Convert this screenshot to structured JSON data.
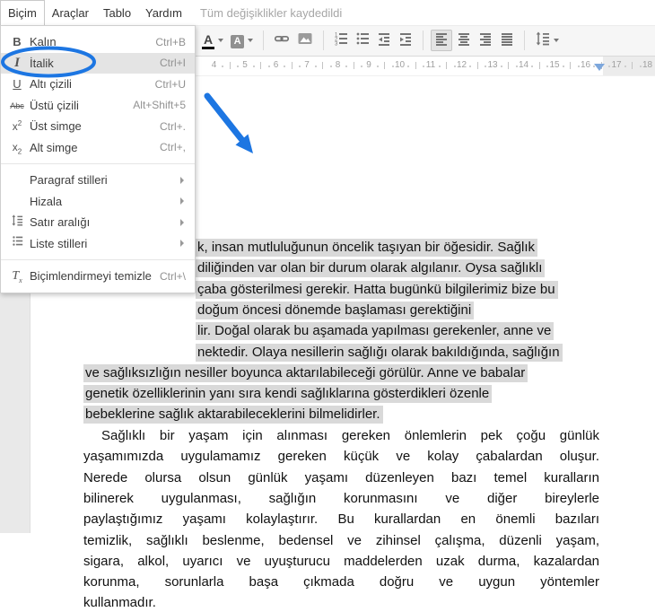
{
  "menubar": {
    "items": [
      "Biçim",
      "Araçlar",
      "Tablo",
      "Yardım"
    ],
    "status": "Tüm değişiklikler kaydedildi"
  },
  "toolbar": {
    "active": "align-left",
    "buttons": [
      {
        "name": "text-color",
        "caret": true
      },
      {
        "name": "highlight-color",
        "caret": true
      },
      {
        "sep": true
      },
      {
        "name": "insert-link"
      },
      {
        "name": "insert-image"
      },
      {
        "sep": true
      },
      {
        "name": "numbered-list"
      },
      {
        "name": "bulleted-list"
      },
      {
        "name": "decrease-indent"
      },
      {
        "name": "increase-indent"
      },
      {
        "sep": true
      },
      {
        "name": "align-left"
      },
      {
        "name": "align-center"
      },
      {
        "name": "align-right"
      },
      {
        "name": "justify"
      },
      {
        "sep": true
      },
      {
        "name": "line-spacing",
        "caret": true
      }
    ]
  },
  "format_menu": {
    "items": [
      {
        "icon": "bold",
        "label": "Kalın",
        "shortcut": "Ctrl+B"
      },
      {
        "icon": "italic",
        "label": "İtalik",
        "shortcut": "Ctrl+I",
        "highlighted": true,
        "circled": true
      },
      {
        "icon": "underline",
        "label": "Altı çizili",
        "shortcut": "Ctrl+U"
      },
      {
        "icon": "strikethrough",
        "label": "Üstü çizili",
        "shortcut": "Alt+Shift+5"
      },
      {
        "icon": "superscript",
        "label": "Üst simge",
        "shortcut": "Ctrl+."
      },
      {
        "icon": "subscript",
        "label": "Alt simge",
        "shortcut": "Ctrl+,"
      },
      {
        "separator": true
      },
      {
        "label": "Paragraf stilleri",
        "submenu": true
      },
      {
        "label": "Hizala",
        "submenu": true
      },
      {
        "icon": "line-spacing",
        "label": "Satır aralığı",
        "submenu": true
      },
      {
        "icon": "list",
        "label": "Liste stilleri",
        "submenu": true
      },
      {
        "separator": true
      },
      {
        "icon": "clear-format",
        "label": "Biçimlendirmeyi temizle",
        "shortcut": "Ctrl+\\"
      }
    ]
  },
  "ruler": {
    "numbers": [
      4,
      5,
      6,
      7,
      8,
      9,
      10,
      11,
      12,
      13,
      14,
      15,
      16,
      17,
      18
    ]
  },
  "document": {
    "selection_color": "#d9d9d9",
    "para1_lines": [
      "k, insan mutluluğunun öncelik taşıyan bir öğesidir. Sağlık",
      "diliğinden var olan bir durum olarak algılanır. Oysa sağlıklı",
      "çaba gösterilmesi gerekir. Hatta bugünkü bilgilerimiz bize bu",
      "doğum öncesi dönemde başlaması gerektiğini",
      "lir. Doğal olarak bu aşamada yapılması gerekenler, anne ve",
      "nektedir. Olaya nesillerin sağlığı olarak bakıldığında, sağlığın",
      "ve sağlıksızlığın nesiller boyunca aktarılabileceği görülür. Anne ve babalar",
      "genetik özelliklerinin yanı sıra kendi sağlıklarına gösterdikleri özenle",
      "bebeklerine sağlık aktarabileceklerini bilmelidirler."
    ],
    "para2_lines": [
      "Sağlıklı bir yaşam için alınması gereken önlemlerin pek çoğu günlük",
      "yaşamımızda uygulamamız gereken küçük ve kolay çabalardan oluşur.",
      "Nerede olursa olsun günlük yaşamı düzenleyen bazı temel kuralların",
      "bilinerek uygulanması, sağlığın korunmasını ve diğer bireylerle",
      "paylaştığımız yaşamı kolaylaştırır. Bu kurallardan en önemli bazıları",
      "temizlik, sağlıklı beslenme, bedensel ve zihinsel çalışma, düzenli yaşam,",
      "sigara, alkol, uyarıcı ve uyuşturucu maddelerden uzak durma, kazalardan",
      "korunma, sorunlarla başa çıkmada doğru ve uygun yöntemler",
      "kullanmadır."
    ]
  },
  "annotation": {
    "color": "#1d76e2",
    "circled_item": "İtalik"
  }
}
